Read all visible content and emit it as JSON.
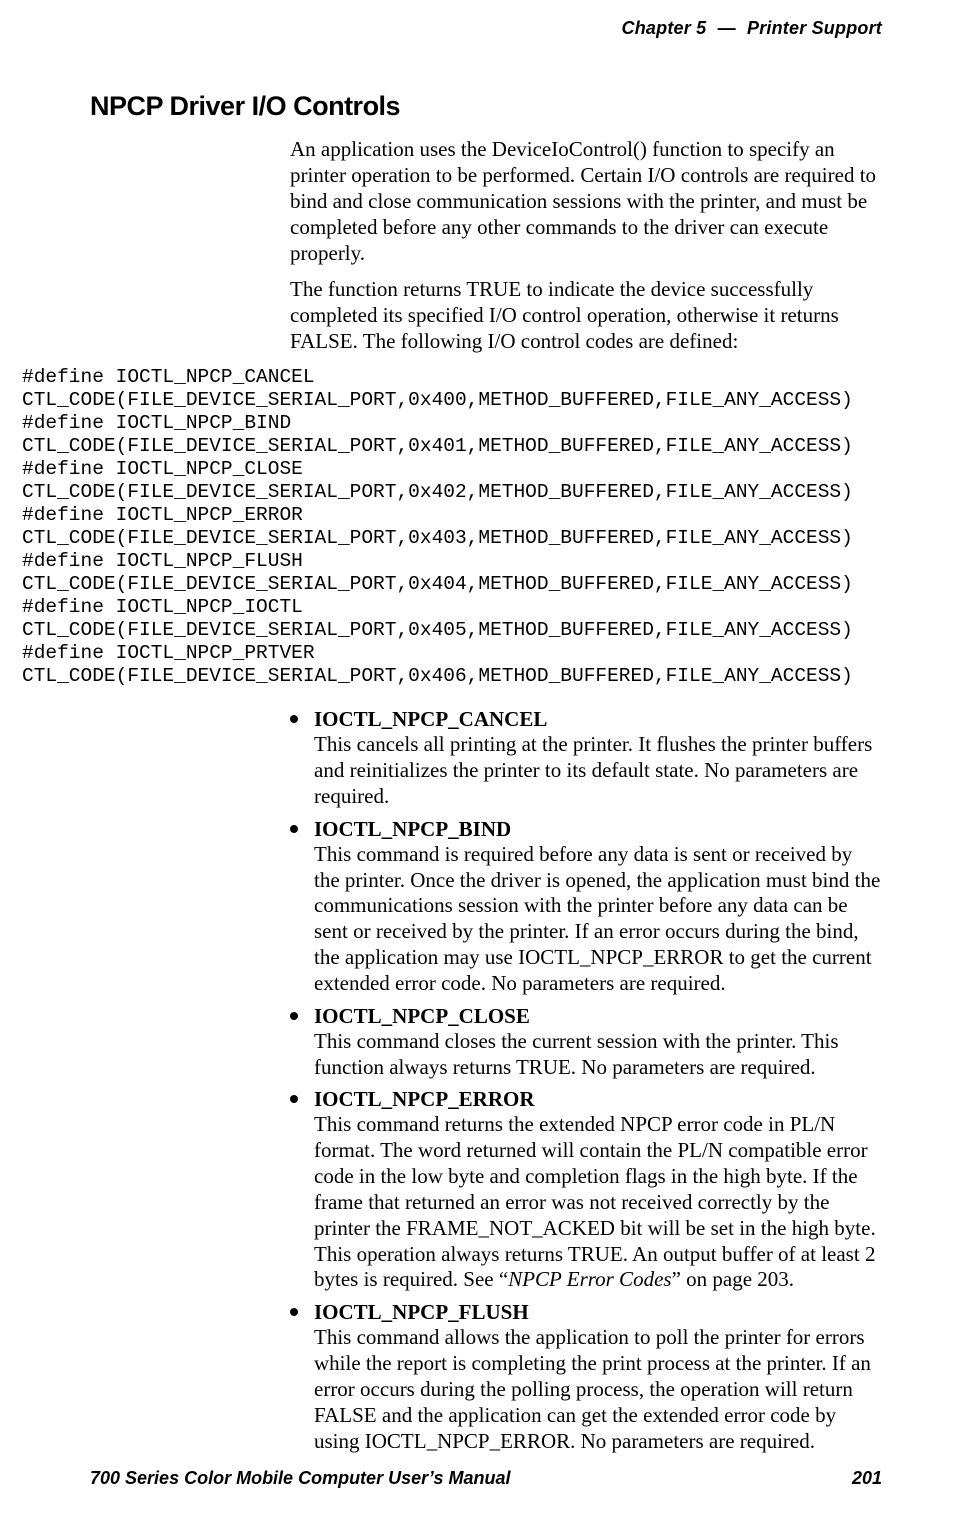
{
  "header": {
    "chapter_label": "Chapter",
    "chapter_number": "5",
    "dash": "—",
    "section": "Printer Support"
  },
  "section_title": "NPCP Driver I/O Controls",
  "intro_para_1": "An application uses the DeviceIoControl() function to specify an printer operation to be performed. Certain I/O controls are required to bind and close communication sessions with the printer, and must be completed before any other commands to the driver can execute properly.",
  "intro_para_2": "The function returns TRUE to indicate the device successfully completed its specified I/O control operation, otherwise it returns FALSE. The following I/O control codes are defined:",
  "code_block": "#define IOCTL_NPCP_CANCEL\nCTL_CODE(FILE_DEVICE_SERIAL_PORT,0x400,METHOD_BUFFERED,FILE_ANY_ACCESS)\n#define IOCTL_NPCP_BIND\nCTL_CODE(FILE_DEVICE_SERIAL_PORT,0x401,METHOD_BUFFERED,FILE_ANY_ACCESS)\n#define IOCTL_NPCP_CLOSE\nCTL_CODE(FILE_DEVICE_SERIAL_PORT,0x402,METHOD_BUFFERED,FILE_ANY_ACCESS)\n#define IOCTL_NPCP_ERROR\nCTL_CODE(FILE_DEVICE_SERIAL_PORT,0x403,METHOD_BUFFERED,FILE_ANY_ACCESS)\n#define IOCTL_NPCP_FLUSH\nCTL_CODE(FILE_DEVICE_SERIAL_PORT,0x404,METHOD_BUFFERED,FILE_ANY_ACCESS)\n#define IOCTL_NPCP_IOCTL\nCTL_CODE(FILE_DEVICE_SERIAL_PORT,0x405,METHOD_BUFFERED,FILE_ANY_ACCESS)\n#define IOCTL_NPCP_PRTVER\nCTL_CODE(FILE_DEVICE_SERIAL_PORT,0x406,METHOD_BUFFERED,FILE_ANY_ACCESS)",
  "bullets": [
    {
      "head": "IOCTL_NPCP_CANCEL",
      "body": "This cancels all printing at the printer. It flushes the printer buffers and reinitializes the printer to its default state. No parameters are required."
    },
    {
      "head": "IOCTL_NPCP_BIND",
      "body": "This command is required before any data is sent or received by the printer. Once the driver is opened, the application must bind the communications session with the printer before any data can be sent or received by the printer. If an error occurs during the bind, the application may use IOCTL_NPCP_ERROR to get the current extended error code. No parameters are required."
    },
    {
      "head": "IOCTL_NPCP_CLOSE",
      "body": "This command closes the current session with the printer. This function always returns TRUE. No parameters are required."
    },
    {
      "head": "IOCTL_NPCP_ERROR",
      "body_pre": "This command returns the extended NPCP error code in PL/N format. The word returned will contain the PL/N compatible error code in the low byte and completion flags in the high byte. If the frame that returned an error was not received correctly by the printer the FRAME_NOT_ACKED bit will be set in the high byte. This operation always returns TRUE. An output buffer of at least 2 bytes is required. See “",
      "body_em": "NPCP Error Codes",
      "body_post": "” on page 203."
    },
    {
      "head": "IOCTL_NPCP_FLUSH",
      "body": "This command allows the application to poll the printer for errors while the report is completing the print process at the printer. If an error occurs during the polling process, the operation will return FALSE and the application can get the extended error code by using IOCTL_NPCP_ERROR. No parameters are required."
    }
  ],
  "footer": {
    "manual_title": "700 Series Color Mobile Computer User’s Manual",
    "page_number": "201"
  }
}
